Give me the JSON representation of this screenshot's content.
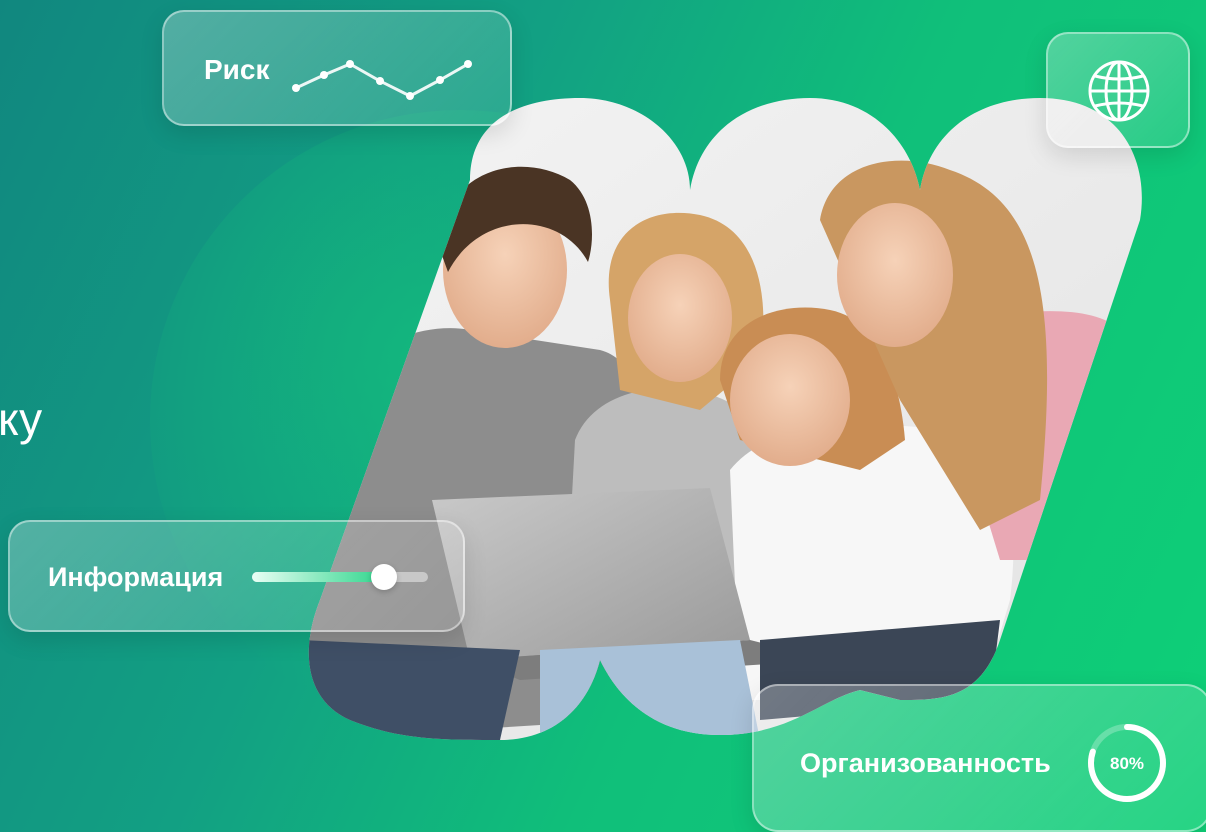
{
  "left_text": "ку",
  "cards": {
    "risk": {
      "label": "Риск",
      "chart_icon": "line-chart-icon"
    },
    "globe": {
      "icon": "globe-icon"
    },
    "info": {
      "label": "Информация",
      "slider_value": 0.75
    },
    "organization": {
      "label": "Организованность",
      "progress_text": "80%",
      "progress_value": 0.8
    }
  },
  "photo": {
    "description_icon": "family-photo"
  },
  "colors": {
    "accent": "#0ed077",
    "teal": "#11877f",
    "white": "#ffffff"
  }
}
